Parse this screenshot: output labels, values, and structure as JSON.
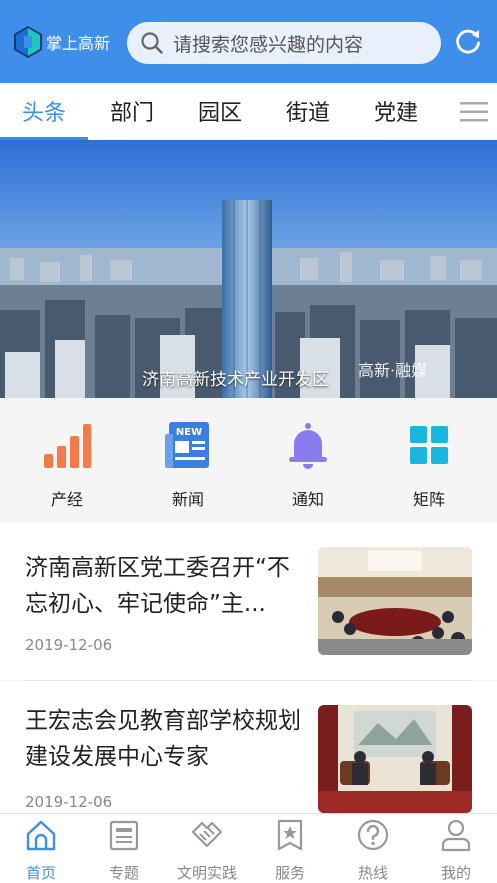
{
  "header": {
    "app_name": "掌上高新",
    "search_placeholder": "请搜索您感兴趣的内容"
  },
  "tabs": [
    {
      "label": "头条",
      "active": true
    },
    {
      "label": "部门"
    },
    {
      "label": "园区"
    },
    {
      "label": "街道"
    },
    {
      "label": "党建"
    }
  ],
  "banner": {
    "caption": "济南高新技术产业开发区",
    "watermark": "高新·融媒"
  },
  "quick_links": [
    {
      "label": "产经",
      "icon": "bar-chart-icon"
    },
    {
      "label": "新闻",
      "icon": "newspaper-icon"
    },
    {
      "label": "通知",
      "icon": "bell-icon"
    },
    {
      "label": "矩阵",
      "icon": "grid-icon"
    }
  ],
  "news": [
    {
      "title": "济南高新区党工委召开“不忘初心、牢记使命”主...",
      "date": "2019-12-06"
    },
    {
      "title": "王宏志会见教育部学校规划建设发展中心专家",
      "date": "2019-12-06"
    }
  ],
  "bottom_nav": [
    {
      "label": "首页",
      "icon": "home-icon",
      "active": true
    },
    {
      "label": "专题",
      "icon": "topic-icon"
    },
    {
      "label": "文明实践",
      "icon": "handshake-icon"
    },
    {
      "label": "服务",
      "icon": "service-icon"
    },
    {
      "label": "热线",
      "icon": "question-icon"
    },
    {
      "label": "我的",
      "icon": "user-icon"
    }
  ],
  "colors": {
    "accent": "#3f8fea",
    "header_bg": "#3f8fea",
    "bar_chart": "#f47a4a",
    "newspaper": "#3d7fe0",
    "bell": "#8a7cf0",
    "grid": "#1bb6e0"
  }
}
